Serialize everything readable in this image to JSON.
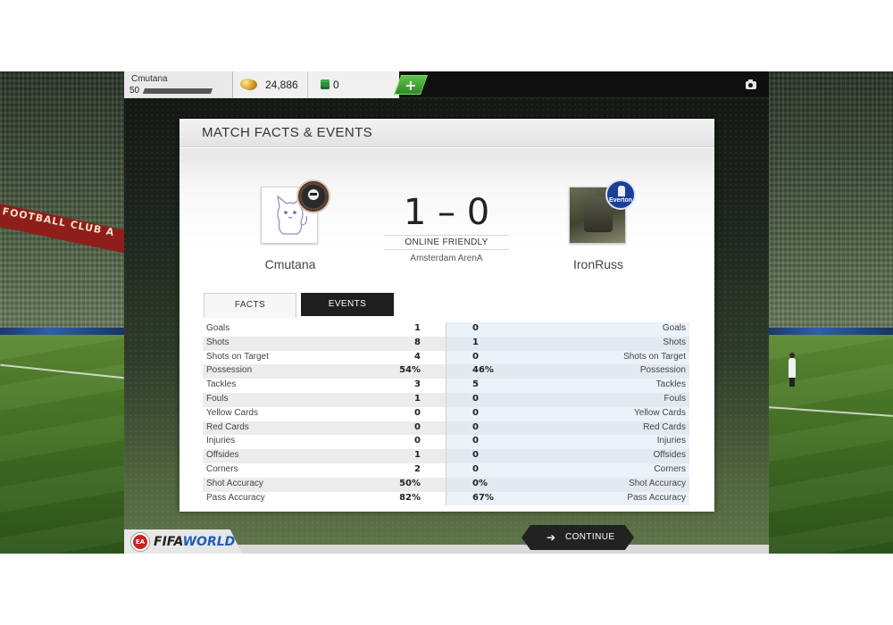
{
  "background": {
    "banner_text": "FOOTBALL CLUB A"
  },
  "topbar": {
    "user_name": "Cmutana",
    "user_level": "50",
    "coins": "24,886",
    "points": "0",
    "add_label": "+"
  },
  "panel": {
    "title": "MATCH FACTS & EVENTS"
  },
  "match": {
    "home_team": "Cmutana",
    "away_team": "IronRuss",
    "away_club_badge": "Everton",
    "score": "1 – 0",
    "match_type": "ONLINE FRIENDLY",
    "venue": "Amsterdam ArenA"
  },
  "tabs": {
    "facts": "FACTS",
    "events": "EVENTS"
  },
  "stats": [
    {
      "label": "Goals",
      "home": "1",
      "away": "0"
    },
    {
      "label": "Shots",
      "home": "8",
      "away": "1"
    },
    {
      "label": "Shots on Target",
      "home": "4",
      "away": "0"
    },
    {
      "label": "Possession",
      "home": "54%",
      "away": "46%"
    },
    {
      "label": "Tackles",
      "home": "3",
      "away": "5"
    },
    {
      "label": "Fouls",
      "home": "1",
      "away": "0"
    },
    {
      "label": "Yellow Cards",
      "home": "0",
      "away": "0"
    },
    {
      "label": "Red Cards",
      "home": "0",
      "away": "0"
    },
    {
      "label": "Injuries",
      "home": "0",
      "away": "0"
    },
    {
      "label": "Offsides",
      "home": "1",
      "away": "0"
    },
    {
      "label": "Corners",
      "home": "2",
      "away": "0"
    },
    {
      "label": "Shot Accuracy",
      "home": "50%",
      "away": "0%"
    },
    {
      "label": "Pass Accuracy",
      "home": "82%",
      "away": "67%"
    }
  ],
  "footer": {
    "continue_label": "CONTINUE",
    "continue_icon": "arrow-right-icon",
    "logo_ea": "EA",
    "logo_fifa": "FIFA",
    "logo_world": "WORLD"
  },
  "colors": {
    "accent_green": "#2f8a24",
    "dark_button": "#222222",
    "away_badge_blue": "#1a3f9a"
  }
}
